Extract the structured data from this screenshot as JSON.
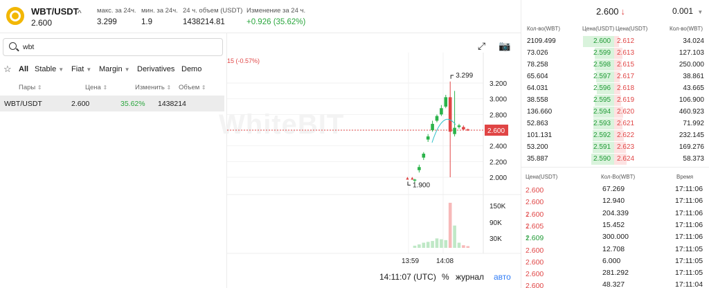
{
  "header": {
    "pair": "WBT/USDT",
    "price": "2.600",
    "chevron": "^",
    "stats": [
      {
        "label": "макс. за 24ч.",
        "value": "3.299"
      },
      {
        "label": "мин. за 24ч.",
        "value": "1.9"
      },
      {
        "label": "24 ч. объем (USDT)",
        "value": "1438214.81"
      },
      {
        "label": "Изменение за 24 ч.",
        "value": "+0.926  (35.62%)"
      }
    ]
  },
  "markets": {
    "search_value": "wbt",
    "filters": [
      "All",
      "Stable",
      "Fiat",
      "Margin",
      "Derivatives",
      "Demo"
    ],
    "columns": [
      "Пары",
      "Цена",
      "Изменить",
      "Объем"
    ],
    "rows": [
      {
        "pair": "WBT/USDT",
        "price": "2.600",
        "change": "35.62%",
        "volume": "1438214"
      }
    ]
  },
  "chart": {
    "watermark": "WhiteBIT",
    "change_label": "15 (-0.57%)",
    "high_label": "3.299",
    "low_label": "1.900",
    "price_ticks": [
      "3.200",
      "3.000",
      "2.800",
      "2.600",
      "2.400",
      "2.200",
      "2.000"
    ],
    "current_price_tag": "2.600",
    "volume_ticks": [
      "150K",
      "90K",
      "30K"
    ],
    "time_ticks": [
      "13:59",
      "14:08"
    ],
    "clock": "14:11:07 (UTC)",
    "percent_btn": "%",
    "log_btn": "журнал",
    "auto_btn": "авто"
  },
  "chart_data": {
    "type": "candlestick",
    "ylim": [
      1.85,
      3.35
    ],
    "candles": [
      {
        "o": 1.96,
        "h": 1.98,
        "l": 1.93,
        "c": 1.97
      },
      {
        "o": 2.09,
        "h": 2.16,
        "l": 2.06,
        "c": 2.13
      },
      {
        "o": 2.25,
        "h": 2.32,
        "l": 2.22,
        "c": 2.3
      },
      {
        "o": 2.48,
        "h": 2.55,
        "l": 2.45,
        "c": 2.52
      },
      {
        "o": 2.6,
        "h": 2.72,
        "l": 2.58,
        "c": 2.68
      },
      {
        "o": 2.72,
        "h": 2.8,
        "l": 2.7,
        "c": 2.78
      },
      {
        "o": 2.8,
        "h": 2.92,
        "l": 2.78,
        "c": 2.88
      },
      {
        "o": 2.9,
        "h": 3.05,
        "l": 2.88,
        "c": 3.02
      },
      {
        "o": 3.02,
        "h": 3.22,
        "l": 2.0,
        "c": 2.58
      },
      {
        "o": 2.55,
        "h": 3.1,
        "l": 2.52,
        "c": 2.63
      },
      {
        "o": 2.64,
        "h": 2.68,
        "l": 2.62,
        "c": 2.66
      },
      {
        "o": 2.64,
        "h": 2.66,
        "l": 2.6,
        "c": 2.61
      },
      {
        "o": 2.61,
        "h": 2.62,
        "l": 2.59,
        "c": 2.6
      }
    ],
    "volumes": [
      5,
      8,
      12,
      14,
      16,
      22,
      20,
      18,
      105,
      52,
      12,
      6,
      4
    ]
  },
  "orderbook": {
    "price": "2.600",
    "price_arrow": "↓",
    "step": "0.001",
    "headers": [
      "Кол-во(WBT)",
      "Цена(USDT)",
      "Цена(USDT)",
      "Кол-во(WBT)"
    ],
    "rows": [
      {
        "bq": "2109.499",
        "bp": "2.600",
        "ap": "2.612",
        "aq": "34.024",
        "bf": 0.9,
        "af": 0.12
      },
      {
        "bq": "73.026",
        "bp": "2.599",
        "ap": "2.613",
        "aq": "127.103",
        "bf": 0.55,
        "af": 0.2
      },
      {
        "bq": "78.258",
        "bp": "2.598",
        "ap": "2.615",
        "aq": "250.000",
        "bf": 0.55,
        "af": 0.18
      },
      {
        "bq": "65.604",
        "bp": "2.597",
        "ap": "2.617",
        "aq": "38.861",
        "bf": 0.52,
        "af": 0.14
      },
      {
        "bq": "64.031",
        "bp": "2.596",
        "ap": "2.618",
        "aq": "43.665",
        "bf": 0.5,
        "af": 0.15
      },
      {
        "bq": "38.558",
        "bp": "2.595",
        "ap": "2.619",
        "aq": "106.900",
        "bf": 0.55,
        "af": 0.16
      },
      {
        "bq": "136.660",
        "bp": "2.594",
        "ap": "2.620",
        "aq": "460.923",
        "bf": 0.6,
        "af": 0.22
      },
      {
        "bq": "52.863",
        "bp": "2.593",
        "ap": "2.621",
        "aq": "71.992",
        "bf": 0.6,
        "af": 0.2
      },
      {
        "bq": "101.131",
        "bp": "2.592",
        "ap": "2.622",
        "aq": "232.145",
        "bf": 0.62,
        "af": 0.24
      },
      {
        "bq": "53.200",
        "bp": "2.591",
        "ap": "2.623",
        "aq": "169.276",
        "bf": 0.62,
        "af": 0.28
      },
      {
        "bq": "35.887",
        "bp": "2.590",
        "ap": "2.624",
        "aq": "58.373",
        "bf": 0.65,
        "af": 0.3
      }
    ]
  },
  "trades": {
    "headers": [
      "Цена(USDT)",
      "Кол-Во(WBT)",
      "Время"
    ],
    "rows": [
      {
        "price": "2.600",
        "qty": "67.269",
        "time": "17:11:06",
        "side": "sell",
        "arrow": ""
      },
      {
        "price": "2.600",
        "qty": "12.940",
        "time": "17:11:06",
        "side": "sell",
        "arrow": ""
      },
      {
        "price": "2.600",
        "qty": "204.339",
        "time": "17:11:06",
        "side": "sell",
        "arrow": "↓"
      },
      {
        "price": "2.605",
        "qty": "15.452",
        "time": "17:11:06",
        "side": "sell",
        "arrow": "↓"
      },
      {
        "price": "2.609",
        "qty": "300.000",
        "time": "17:11:06",
        "side": "buy",
        "arrow": "↑"
      },
      {
        "price": "2.600",
        "qty": "12.708",
        "time": "17:11:05",
        "side": "sell",
        "arrow": ""
      },
      {
        "price": "2.600",
        "qty": "6.000",
        "time": "17:11:05",
        "side": "sell",
        "arrow": ""
      },
      {
        "price": "2.600",
        "qty": "281.292",
        "time": "17:11:05",
        "side": "sell",
        "arrow": ""
      },
      {
        "price": "2.600",
        "qty": "48.327",
        "time": "17:11:04",
        "side": "sell",
        "arrow": ""
      }
    ]
  },
  "colors": {
    "up": "#2bb34a",
    "down": "#e04545",
    "accent": "#2f7cf6"
  }
}
